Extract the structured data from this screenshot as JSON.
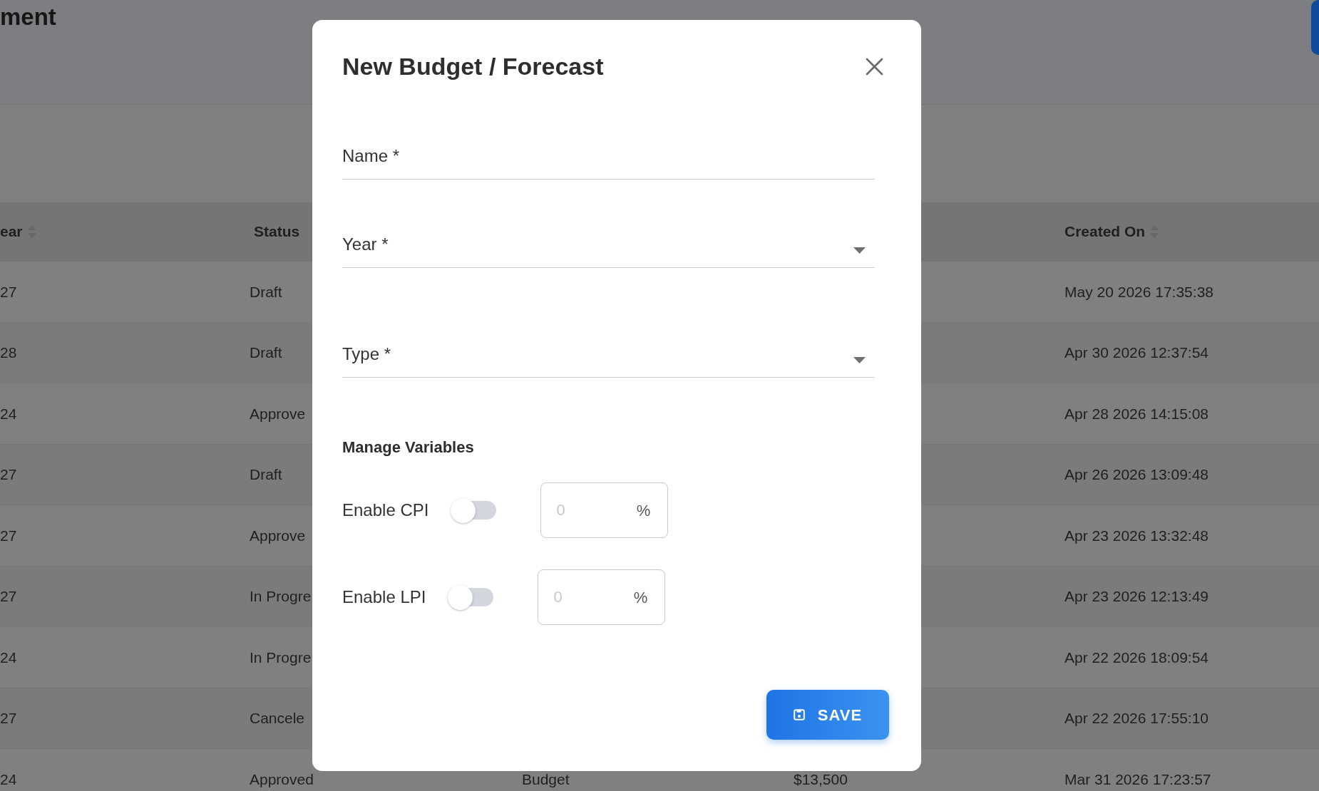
{
  "page": {
    "heading": "ment",
    "table": {
      "header": {
        "column_1": {
          "label": "ear",
          "sortable": true
        },
        "status": {
          "label": "Status",
          "sortable": false
        },
        "created_on": {
          "label": "Created On",
          "sortable": true
        }
      },
      "rows": [
        {
          "column_1": "27",
          "status": "Draft",
          "created_on": "May 20 2026 17:35:38"
        },
        {
          "column_1": "28",
          "status": "Draft",
          "created_on": "Apr 30 2026 12:37:54"
        },
        {
          "column_1": "24",
          "status": "Approve",
          "created_on": "Apr 28 2026 14:15:08"
        },
        {
          "column_1": "27",
          "status": "Draft",
          "created_on": "Apr 26 2026 13:09:48"
        },
        {
          "column_1": "27",
          "status": "Approve",
          "created_on": "Apr 23 2026 13:32:48"
        },
        {
          "column_1": "27",
          "status": "In Progre",
          "created_on": "Apr 23 2026 12:13:49"
        },
        {
          "column_1": "24",
          "status": "In Progre",
          "created_on": "Apr 22 2026 18:09:54"
        },
        {
          "column_1": "27",
          "status": "Cancele",
          "created_on": "Apr 22 2026 17:55:10"
        },
        {
          "column_1": "24",
          "status": "Approved",
          "column_3": "Budget",
          "column_4": "$13,500",
          "created_on": "Mar 31 2026 17:23:57"
        }
      ]
    }
  },
  "dialog": {
    "title": "New Budget / Forecast",
    "fields": [
      {
        "kind": "text",
        "placeholder": "Name *"
      },
      {
        "kind": "select",
        "label": "Year *"
      },
      {
        "kind": "select",
        "label": "Type *"
      }
    ],
    "section_title": "Manage Variables",
    "variables": [
      {
        "label": "Enable CPI",
        "on": false,
        "placeholder": "0",
        "unit": "%"
      },
      {
        "label": "Enable LPI",
        "on": false,
        "placeholder": "0",
        "unit": "%"
      }
    ],
    "save_button": "SAVE"
  }
}
